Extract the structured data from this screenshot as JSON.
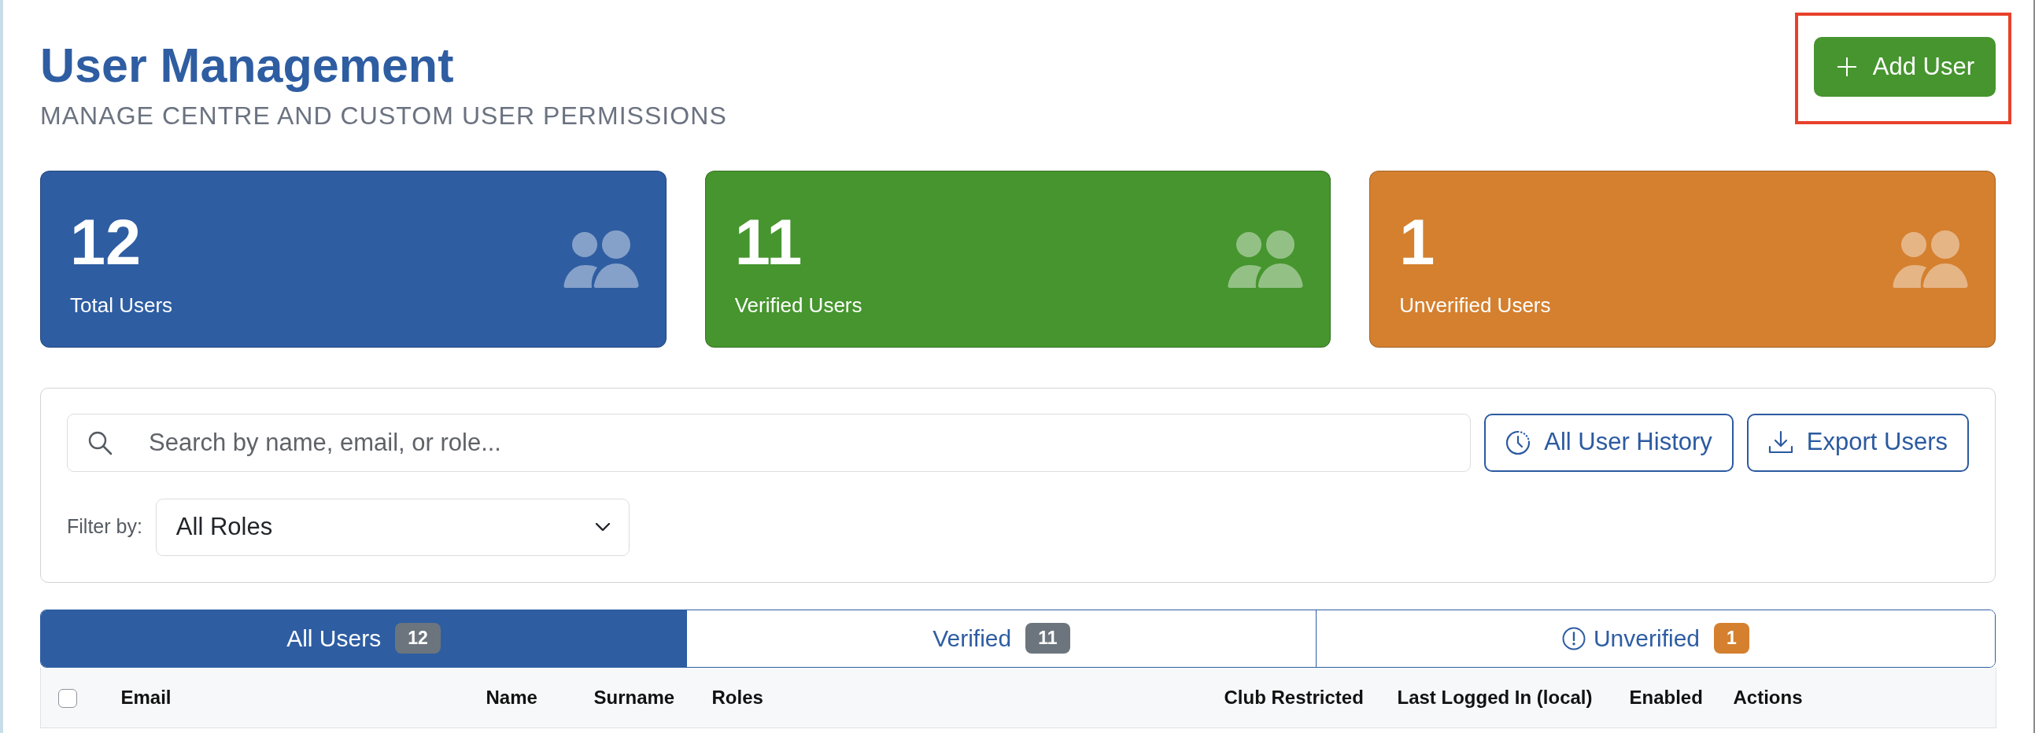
{
  "header": {
    "title": "User Management",
    "subtitle": "MANAGE CENTRE AND CUSTOM USER PERMISSIONS"
  },
  "add_user": {
    "label": "Add User",
    "highlighted": true
  },
  "stats": [
    {
      "value": "12",
      "label": "Total Users",
      "color": "#2e5da2"
    },
    {
      "value": "11",
      "label": "Verified Users",
      "color": "#46952e"
    },
    {
      "value": "1",
      "label": "Unverified Users",
      "color": "#d4802f"
    }
  ],
  "search": {
    "placeholder": "Search by name, email, or role..."
  },
  "actions": [
    {
      "label": "All User History",
      "kind": "history"
    },
    {
      "label": "Export Users",
      "kind": "export"
    }
  ],
  "filter": {
    "label": "Filter by:",
    "value": "All Roles"
  },
  "tabs": [
    {
      "label": "All Users",
      "count": "12",
      "selected": true,
      "kind": "plain",
      "color": "#6c757d"
    },
    {
      "label": "Verified",
      "count": "11",
      "selected": false,
      "kind": "plain",
      "color": "#6c757d"
    },
    {
      "label": "Unverified",
      "count": "1",
      "selected": false,
      "kind": "warning",
      "color": "#d4802f"
    }
  ],
  "table": {
    "select_all": {
      "checked": false
    },
    "columns": [
      "Email",
      "Name",
      "Surname",
      "Roles",
      "Club Restricted",
      "Last Logged In (local)",
      "Enabled",
      "Actions"
    ]
  }
}
